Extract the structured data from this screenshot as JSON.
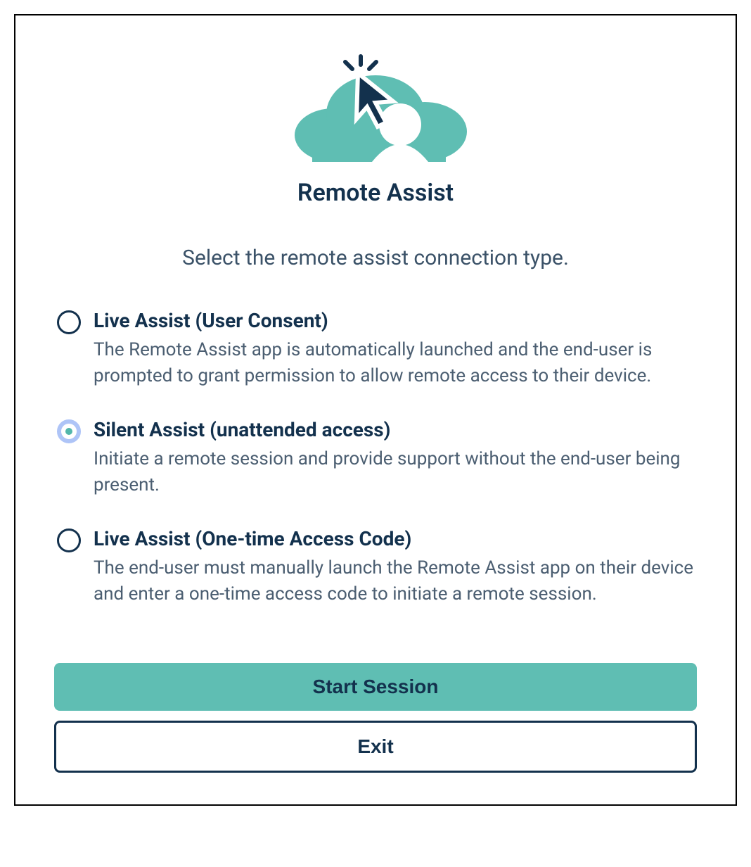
{
  "app_title": "Remote Assist",
  "subtitle": "Select the remote assist connection type.",
  "options": [
    {
      "label": "Live Assist (User Consent)",
      "desc": "The Remote Assist app is automatically launched and the end-user is prompted to grant permission to allow remote access to their device.",
      "selected": false
    },
    {
      "label": "Silent Assist (unattended access)",
      "desc": "Initiate a remote session and provide support without the end-user being present.",
      "selected": true
    },
    {
      "label": "Live Assist (One-time Access Code)",
      "desc": "The end-user must manually launch the Remote Assist app on their device and enter a one-time access code to initiate a remote session.",
      "selected": false
    }
  ],
  "buttons": {
    "primary": "Start Session",
    "secondary": "Exit"
  },
  "colors": {
    "accent": "#5fbeb3",
    "dark": "#13314d"
  }
}
